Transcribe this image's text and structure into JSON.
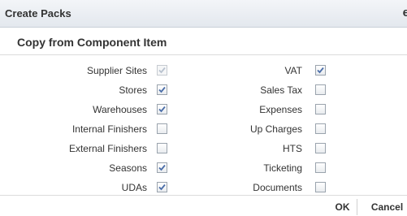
{
  "dialog": {
    "title": "Create Packs",
    "close_glyph": "e",
    "section_title": "Copy from Component Item"
  },
  "left_options": [
    {
      "label": "Supplier Sites",
      "checked": true,
      "disabled": true
    },
    {
      "label": "Stores",
      "checked": true,
      "disabled": false
    },
    {
      "label": "Warehouses",
      "checked": true,
      "disabled": false
    },
    {
      "label": "Internal Finishers",
      "checked": false,
      "disabled": false
    },
    {
      "label": "External Finishers",
      "checked": false,
      "disabled": false
    },
    {
      "label": "Seasons",
      "checked": true,
      "disabled": false
    },
    {
      "label": "UDAs",
      "checked": true,
      "disabled": false
    }
  ],
  "right_options": [
    {
      "label": "VAT",
      "checked": true,
      "disabled": false
    },
    {
      "label": "Sales Tax",
      "checked": false,
      "disabled": false
    },
    {
      "label": "Expenses",
      "checked": false,
      "disabled": false
    },
    {
      "label": "Up Charges",
      "checked": false,
      "disabled": false
    },
    {
      "label": "HTS",
      "checked": false,
      "disabled": false
    },
    {
      "label": "Ticketing",
      "checked": false,
      "disabled": false
    },
    {
      "label": "Documents",
      "checked": false,
      "disabled": false
    }
  ],
  "buttons": {
    "ok_label": "OK",
    "cancel_label": "Cancel"
  },
  "colors": {
    "check_enabled": "#4b6ea9",
    "check_disabled": "#b8c2cf"
  },
  "icons": {
    "checkmark": "check-icon"
  }
}
